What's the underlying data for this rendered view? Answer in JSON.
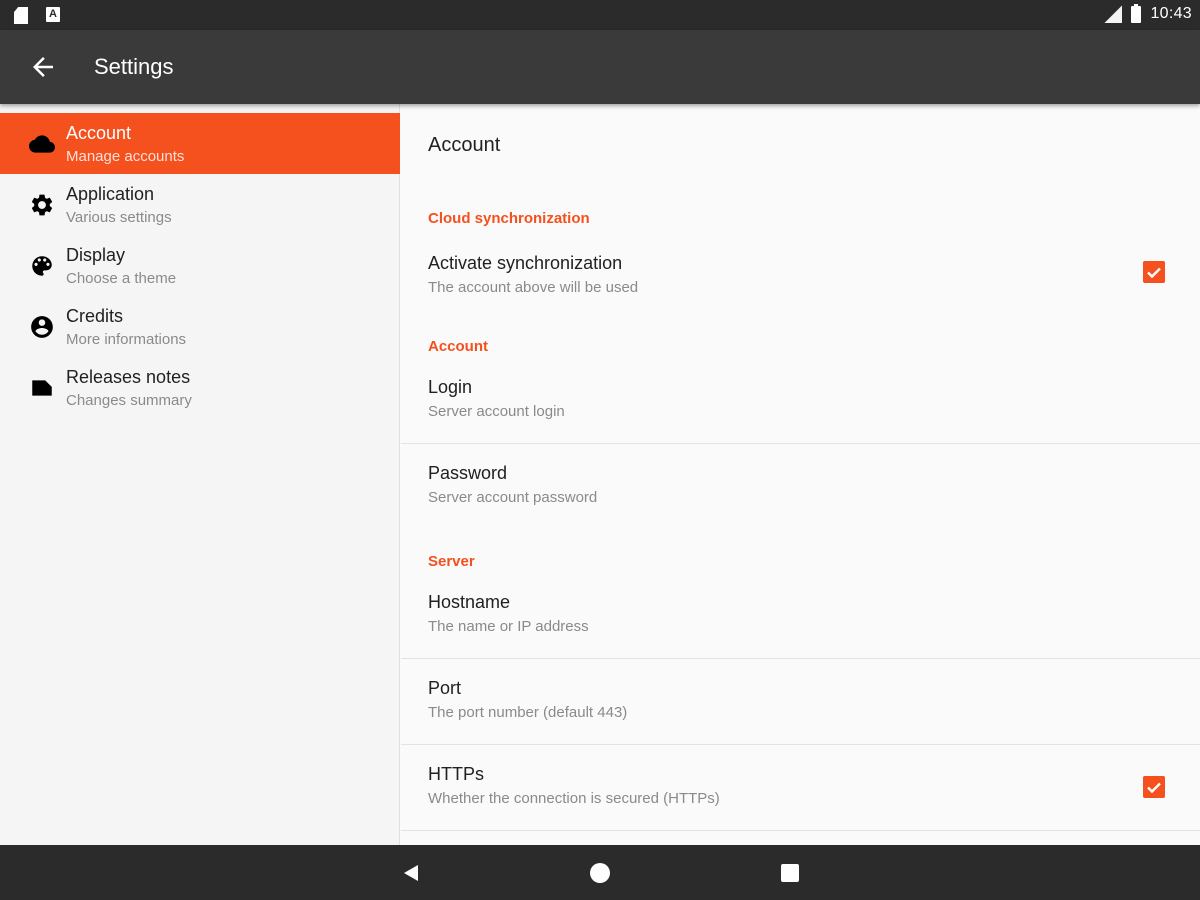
{
  "status_bar": {
    "left_icons": [
      "sd-card-icon",
      "a-icon"
    ],
    "a_icon_glyph": "A",
    "right_icons": [
      "signal-icon",
      "battery-icon"
    ],
    "time": "10:43"
  },
  "app_bar": {
    "back_icon": "arrow-left-icon",
    "title": "Settings"
  },
  "sidebar": {
    "items": [
      {
        "label": "Account",
        "sub": "Manage accounts",
        "icon": "cloud-icon",
        "active": true
      },
      {
        "label": "Application",
        "sub": "Various settings",
        "icon": "gear-icon",
        "active": false
      },
      {
        "label": "Display",
        "sub": "Choose a theme",
        "icon": "palette-icon",
        "active": false
      },
      {
        "label": "Credits",
        "sub": "More informations",
        "icon": "account-circle-icon",
        "active": false
      },
      {
        "label": "Releases notes",
        "sub": "Changes summary",
        "icon": "label-icon",
        "active": false
      }
    ]
  },
  "content": {
    "title": "Account",
    "sections": [
      {
        "header": "Cloud synchronization",
        "prefs": [
          {
            "title": "Activate synchronization",
            "summary": "The account above will be used",
            "checked": true
          }
        ]
      },
      {
        "header": "Account",
        "prefs": [
          {
            "title": "Login",
            "summary": "Server account login"
          },
          {
            "title": "Password",
            "summary": "Server account password"
          }
        ]
      },
      {
        "header": "Server",
        "prefs": [
          {
            "title": "Hostname",
            "summary": "The name or IP address"
          },
          {
            "title": "Port",
            "summary": "The port number (default 443)"
          },
          {
            "title": "HTTPs",
            "summary": "Whether the connection is secured (HTTPs)",
            "checked": true
          }
        ]
      }
    ]
  },
  "nav_bar": {
    "buttons": [
      "back-triangle-icon",
      "home-circle-icon",
      "recents-square-icon"
    ]
  },
  "colors": {
    "accent": "#f4511e",
    "app_bar": "#3a3a3a",
    "status_bar": "#2b2b2b",
    "background": "#fafafa"
  }
}
